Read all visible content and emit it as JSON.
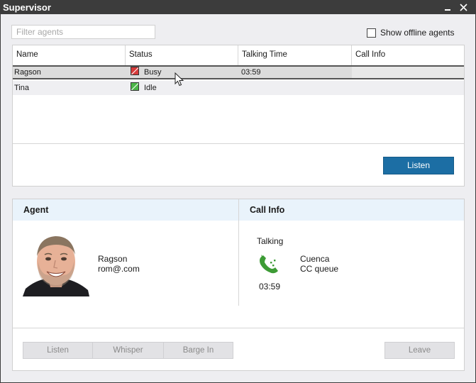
{
  "window": {
    "title": "Supervisor"
  },
  "toolbar": {
    "filter_placeholder": "Filter agents",
    "show_offline_label": "Show offline agents",
    "show_offline_checked": false
  },
  "grid": {
    "columns": [
      "Name",
      "Status",
      "Talking Time",
      "Call Info"
    ],
    "rows": [
      {
        "name": "Ragson",
        "status": "Busy",
        "status_color": "#d63a3a",
        "talking_time": "03:59",
        "call_info": "",
        "selected": true
      },
      {
        "name": "Tina",
        "status": "Idle",
        "status_color": "#4cb648",
        "talking_time": "",
        "call_info": "",
        "selected": false
      }
    ],
    "listen_label": "Listen"
  },
  "detail": {
    "agent_header": "Agent",
    "call_info_header": "Call Info",
    "agent": {
      "name": "Ragson",
      "email": "rom@.com"
    },
    "call": {
      "state": "Talking",
      "duration": "03:59",
      "caller": "Cuenca",
      "queue": "CC queue"
    },
    "buttons": {
      "listen": "Listen",
      "whisper": "Whisper",
      "barge_in": "Barge In",
      "leave": "Leave"
    }
  },
  "colors": {
    "accent": "#1c6ea4",
    "section_header": "#e9f3fb",
    "titlebar": "#3c3c3c",
    "phone_green": "#3d9b35"
  }
}
